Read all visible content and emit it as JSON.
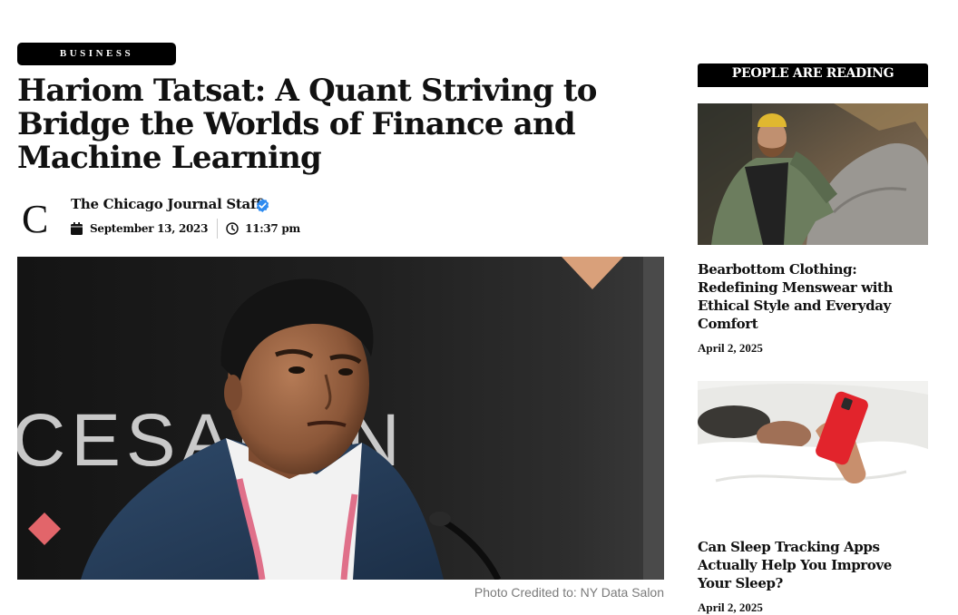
{
  "article": {
    "category": "Business",
    "headline": "Hariom Tatsat: A Quant Striving to Bridge the Worlds of Finance and Machine Learning",
    "author": {
      "avatar_letter": "C",
      "name": "The Chicago Journal Staff",
      "verified_icon": "verified-badge-icon"
    },
    "date": "September 13, 2023",
    "time": "11:37 pm",
    "hero_sign_text": "CESALON",
    "photo_credit": "Photo Credited to: NY Data Salon"
  },
  "sidebar": {
    "heading": "People Are Reading",
    "cards": [
      {
        "title": "Bearbottom Clothing: Redefining Menswear with Ethical Style and Everyday Comfort",
        "date": "April 2, 2025"
      },
      {
        "title": "Can Sleep Tracking Apps Actually Help You Improve Your Sleep?",
        "date": "April 2, 2025"
      }
    ]
  },
  "colors": {
    "badge_bg": "#000000",
    "verified_blue": "#2e8bf0",
    "credit_gray": "#7a7a7a"
  }
}
